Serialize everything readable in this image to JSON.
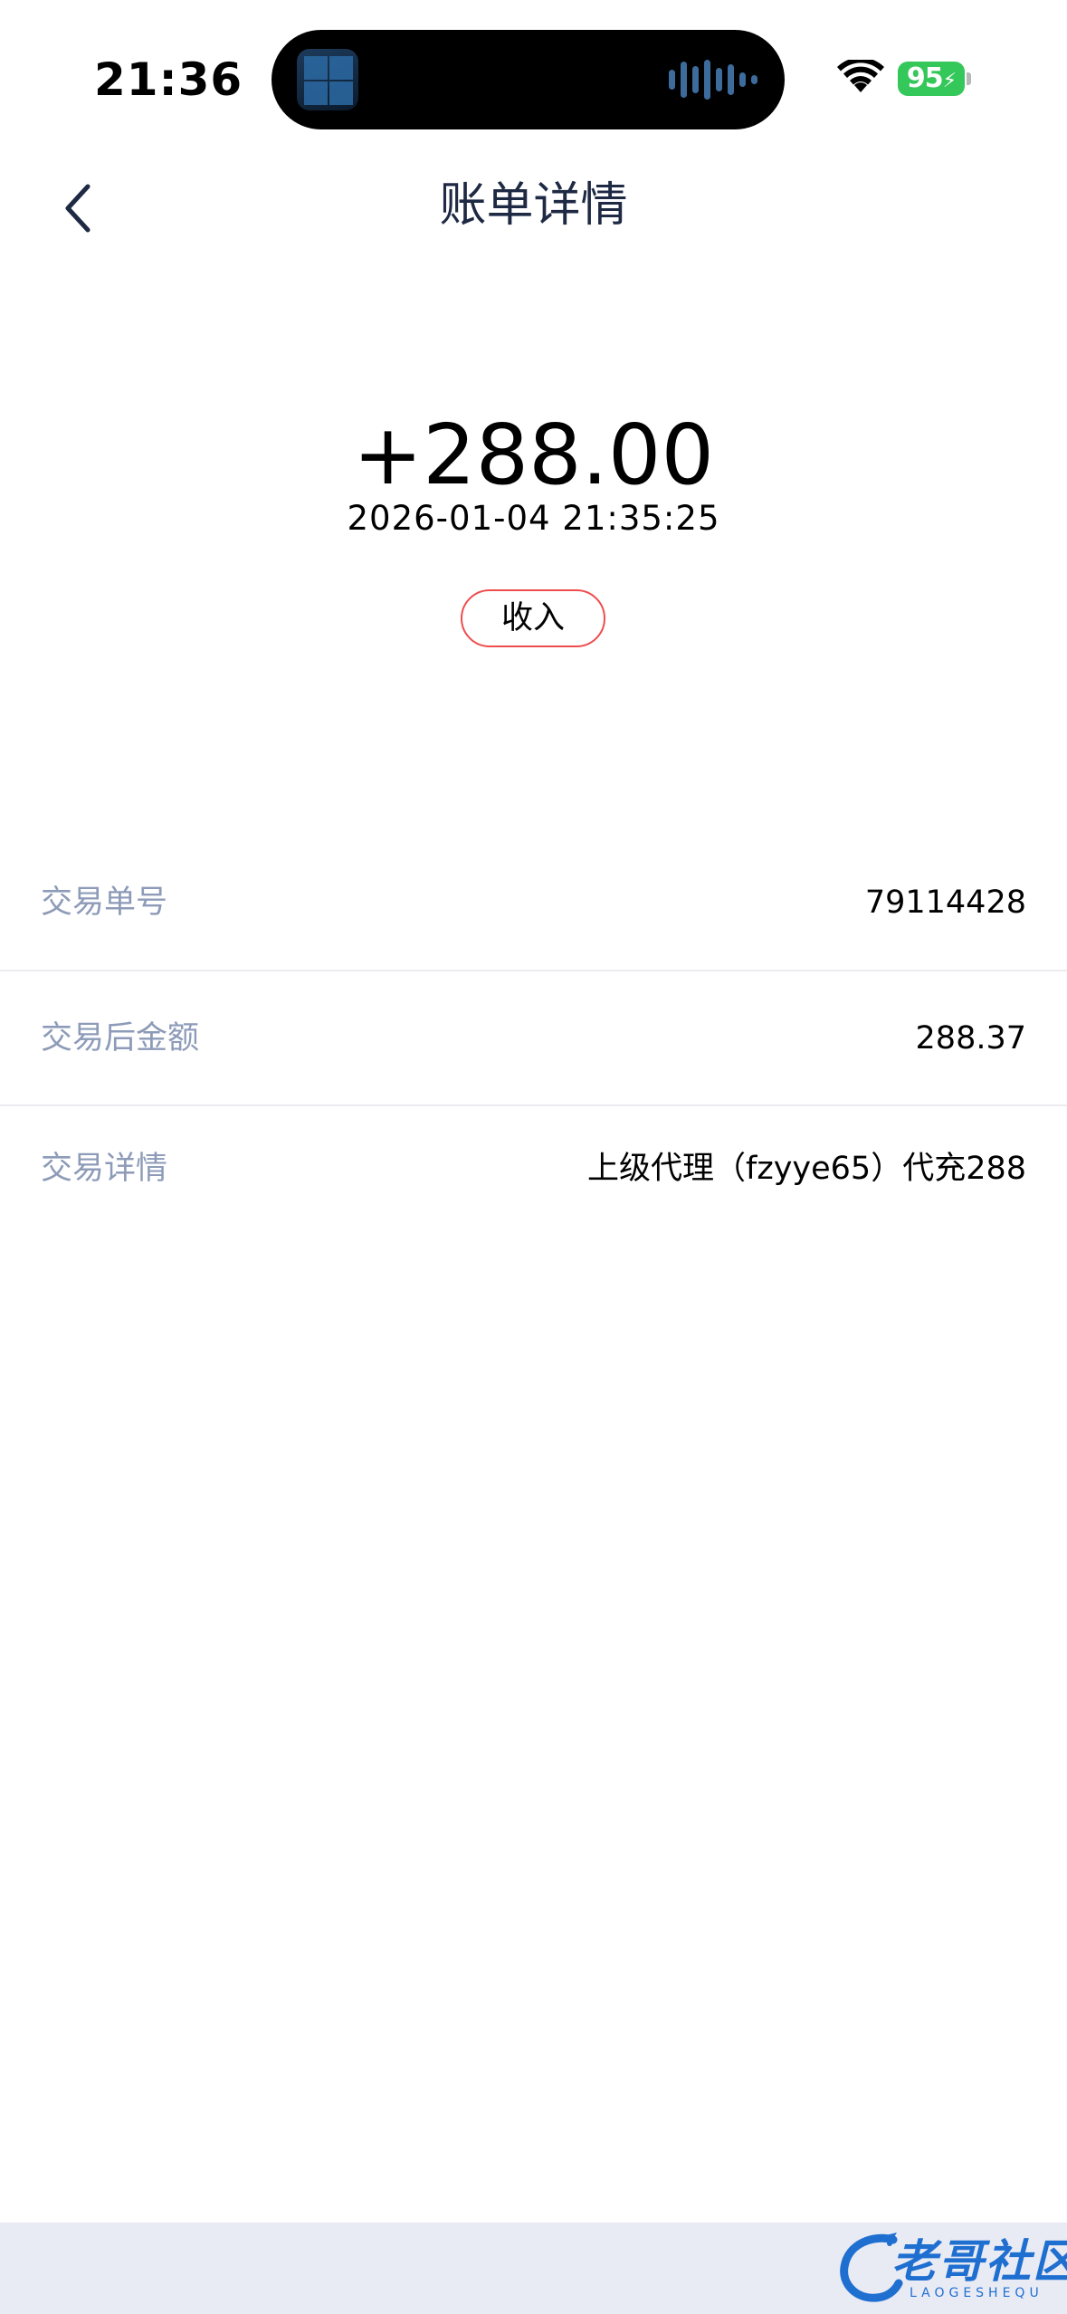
{
  "status_bar": {
    "time": "21:36",
    "battery": "95"
  },
  "nav": {
    "title": "账单详情"
  },
  "transaction": {
    "amount": "+288.00",
    "datetime": "2026-01-04 21:35:25",
    "type": "收入"
  },
  "details": [
    {
      "label": "交易单号",
      "value": "79114428"
    },
    {
      "label": "交易后金额",
      "value": "288.37"
    },
    {
      "label": "交易详情",
      "value": "上级代理（fzyye65）代充288"
    }
  ],
  "watermark": {
    "text": "老哥社区",
    "subtext": "LAOGESHEQU"
  },
  "colors": {
    "title": "#1e2a44",
    "label": "#8d9bb8",
    "badge_border": "#ee4d4d",
    "battery": "#34c759",
    "footer": "#e9ebf4",
    "watermark": "#1f6fd1"
  }
}
